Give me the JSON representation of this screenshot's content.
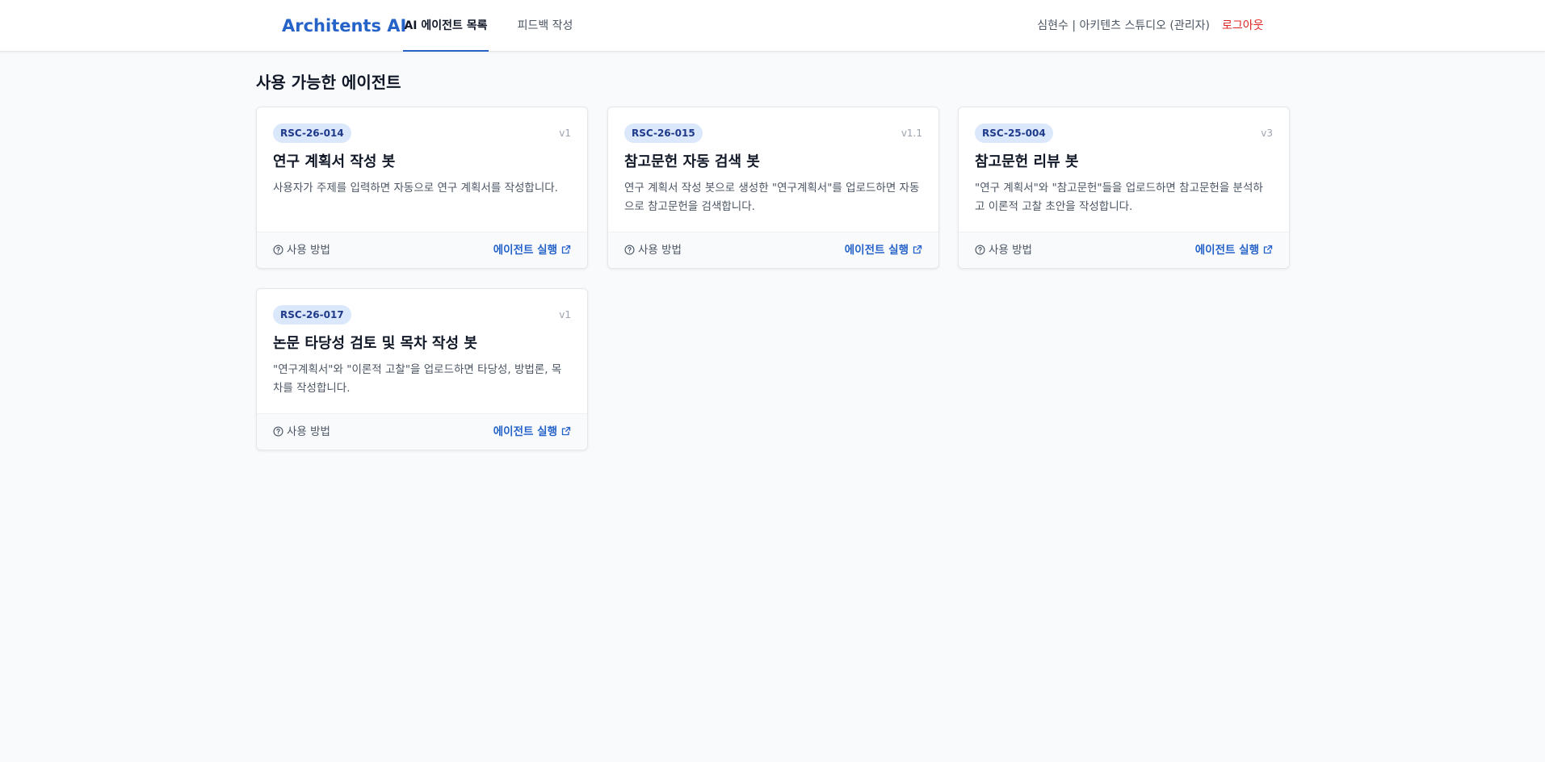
{
  "header": {
    "brand": "Architents AI",
    "tabs": [
      {
        "label": "AI 에이전트 목록",
        "active": true
      },
      {
        "label": "피드백 작성",
        "active": false
      }
    ],
    "user_info": "심현수 | 아키텐츠 스튜디오 (관리자)",
    "logout_label": "로그아웃"
  },
  "main": {
    "title": "사용 가능한 에이전트",
    "agents": [
      {
        "code": "RSC-26-014",
        "version": "v1",
        "title": "연구 계획서 작성 봇",
        "description": "사용자가 주제를 입력하면 자동으로 연구 계획서를 작성합니다.",
        "help_label": "사용 방법",
        "run_label": "에이전트 실행"
      },
      {
        "code": "RSC-26-015",
        "version": "v1.1",
        "title": "참고문헌 자동 검색 봇",
        "description": "연구 계획서 작성 봇으로 생성한 \"연구계획서\"를 업로드하면 자동으로 참고문헌을 검색합니다.",
        "help_label": "사용 방법",
        "run_label": "에이전트 실행"
      },
      {
        "code": "RSC-25-004",
        "version": "v3",
        "title": "참고문헌 리뷰 봇",
        "description": "\"연구 계획서\"와 \"참고문헌\"들을 업로드하면 참고문헌을 분석하고 이론적 고찰 초안을 작성합니다.",
        "help_label": "사용 방법",
        "run_label": "에이전트 실행"
      },
      {
        "code": "RSC-26-017",
        "version": "v1",
        "title": "논문 타당성 검토 및 목차 작성 봇",
        "description": "\"연구계획서\"와 \"이론적 고찰\"을 업로드하면 타당성, 방법론, 목차를 작성합니다.",
        "help_label": "사용 방법",
        "run_label": "에이전트 실행"
      }
    ]
  },
  "icons": {
    "help": "question-circle-icon",
    "run": "external-link-icon"
  },
  "colors": {
    "brand": "#2563c9",
    "logout": "#dc2626",
    "badge_bg": "#dbe7fb",
    "badge_text": "#1e3a8a",
    "background": "#f8fafc"
  }
}
